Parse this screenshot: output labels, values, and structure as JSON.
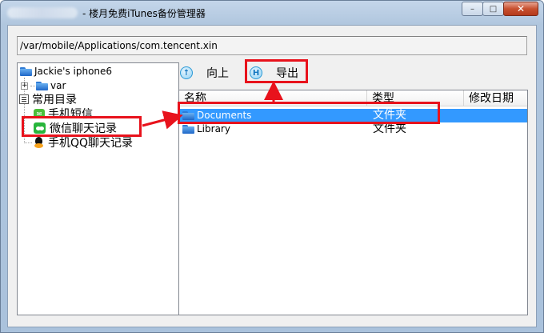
{
  "window": {
    "title": "- 楼月免费iTunes备份管理器",
    "buttons": {
      "minimize": "–",
      "maximize": "□",
      "close": "✕"
    }
  },
  "path_bar": {
    "value": "/var/mobile/Applications/com.tencent.xin"
  },
  "tree": {
    "root_label": "Jackie's iphone6",
    "var_label": "var",
    "common_label": "常用目录",
    "items": [
      {
        "label": "手机短信",
        "icon": "sms-icon"
      },
      {
        "label": "微信聊天记录",
        "icon": "wechat-icon"
      },
      {
        "label": "手机QQ聊天记录",
        "icon": "qq-icon"
      }
    ]
  },
  "toolbar": {
    "up_label": "向上",
    "export_label": "导出"
  },
  "file_list": {
    "columns": [
      "名称",
      "类型",
      "修改日期"
    ],
    "rows": [
      {
        "name": "Documents",
        "type": "文件夹",
        "date": "",
        "selected": true
      },
      {
        "name": "Library",
        "type": "文件夹",
        "date": "",
        "selected": false
      }
    ]
  },
  "colors": {
    "highlight_red": "#e8121c",
    "selection_blue": "#3399ff",
    "folder_blue": "#2f7bd6",
    "wechat_green": "#28b53c"
  }
}
